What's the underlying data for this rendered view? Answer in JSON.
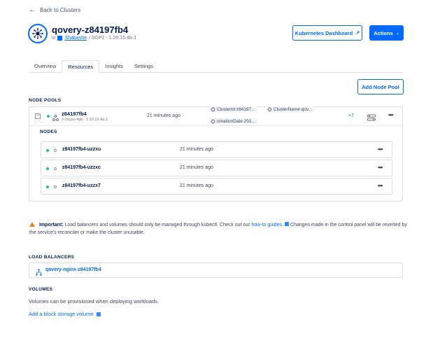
{
  "back_link": "Back to Clusters",
  "cluster": {
    "name": "qovery-z84197fb4",
    "in_label": "in",
    "project": "Shabashe",
    "meta": "/ SGP1 - 1.20.15-do.1"
  },
  "header_buttons": {
    "dashboard": "Kubernetes Dashboard",
    "actions": "Actions"
  },
  "tabs": [
    "Overview",
    "Resources",
    "Insights",
    "Settings"
  ],
  "node_pools": {
    "heading": "NODE POOLS",
    "add_button": "Add Node Pool",
    "pool": {
      "name": "z84197fb4",
      "spec": "s-2vcpu-4gb - 1.20.15-do.1",
      "created": "21 minutes ago",
      "tags": [
        "ClusterId:z84197...",
        "ClusterName:qov...",
        "creationDate:202..."
      ],
      "more_tags": "+7"
    },
    "nodes_heading": "NODES",
    "nodes": [
      {
        "name": "z84197fb4-uzzxu",
        "created": "21 minutes ago"
      },
      {
        "name": "z84197fb4-uzzxc",
        "created": "21 minutes ago"
      },
      {
        "name": "z84197fb4-uzzx7",
        "created": "21 minutes ago"
      }
    ]
  },
  "notice": {
    "bold": "Important:",
    "text1": " Load balancers and volumes should only be managed through kubectl. Check out our ",
    "link": "how-to guides.",
    "text2": " Changes made in the control panel will be reverted by the service's reconciler or make the cluster unusable."
  },
  "load_balancers": {
    "heading": "LOAD BALANCERS",
    "items": [
      "qovery-nginx-z84197fb4"
    ]
  },
  "volumes": {
    "heading": "VOLUMES",
    "empty_text": "Volumes can be provisioned when deploying workloads.",
    "add_link": "Add a block storage volume"
  },
  "colors": {
    "accent": "#0069ff",
    "status_ok": "#15cd72",
    "warning": "#f5821f"
  }
}
